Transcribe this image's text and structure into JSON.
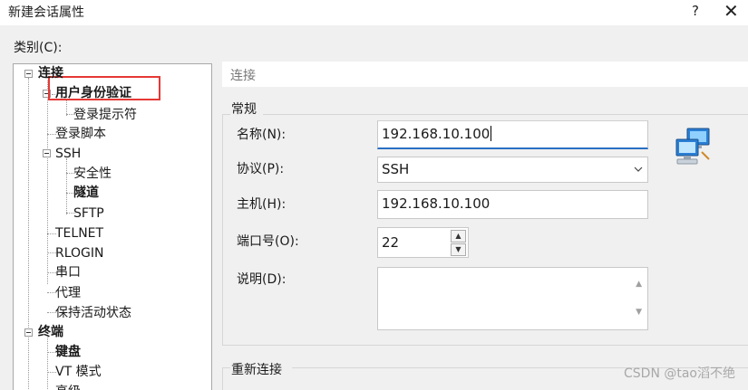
{
  "window": {
    "title": "新建会话属性",
    "help": "?",
    "close": "✕"
  },
  "category_label": "类别(C):",
  "tree": [
    {
      "label": "连接",
      "bold": true
    },
    {
      "label": "用户身份验证",
      "bold": true
    },
    {
      "label": "登录提示符",
      "bold": false
    },
    {
      "label": "登录脚本",
      "bold": false
    },
    {
      "label": "SSH",
      "bold": false
    },
    {
      "label": "安全性",
      "bold": false
    },
    {
      "label": "隧道",
      "bold": true
    },
    {
      "label": "SFTP",
      "bold": false
    },
    {
      "label": "TELNET",
      "bold": false
    },
    {
      "label": "RLOGIN",
      "bold": false
    },
    {
      "label": "串口",
      "bold": false
    },
    {
      "label": "代理",
      "bold": false
    },
    {
      "label": "保持活动状态",
      "bold": false
    },
    {
      "label": "终端",
      "bold": true
    },
    {
      "label": "键盘",
      "bold": true
    },
    {
      "label": "VT 模式",
      "bold": false
    },
    {
      "label": "高级",
      "bold": false
    }
  ],
  "header": {
    "label": "连接"
  },
  "general": {
    "title": "常规",
    "name_label": "名称(N):",
    "name_value": "192.168.10.100",
    "protocol_label": "协议(P):",
    "protocol_value": "SSH",
    "host_label": "主机(H):",
    "host_value": "192.168.10.100",
    "port_label": "端口号(O):",
    "port_value": "22",
    "desc_label": "说明(D):",
    "desc_value": ""
  },
  "reconnect": {
    "title": "重新连接"
  },
  "watermark": "CSDN @tao滔不绝",
  "colors": {
    "highlight_box": "#e53935",
    "focus": "#2a6fc2"
  }
}
